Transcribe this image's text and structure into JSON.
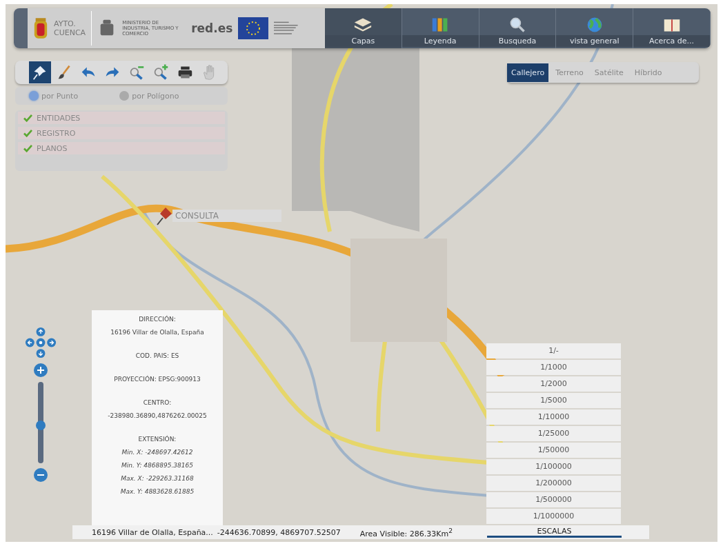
{
  "header": {
    "logo_lines": [
      "AYTO.",
      "CUENCA"
    ],
    "ministry": "MINISTERIO DE INDUSTRIA, TURISMO Y COMERCIO",
    "brand": "red.es"
  },
  "nav": [
    {
      "kind": "layers",
      "label": "Capas",
      "selected": true
    },
    {
      "kind": "legend",
      "label": "Leyenda",
      "selected": false
    },
    {
      "kind": "search",
      "label": "Busqueda",
      "selected": false
    },
    {
      "kind": "globe",
      "label": "vista general",
      "selected": false
    },
    {
      "kind": "book",
      "label": "Acerca de...",
      "selected": false
    }
  ],
  "tools": [
    {
      "kind": "pin",
      "selected": true
    },
    {
      "kind": "brush",
      "selected": false
    },
    {
      "kind": "undo",
      "selected": false
    },
    {
      "kind": "redo",
      "selected": false
    },
    {
      "kind": "zoom-out",
      "selected": false
    },
    {
      "kind": "zoom-in",
      "selected": false
    },
    {
      "kind": "print",
      "selected": false
    },
    {
      "kind": "hand",
      "selected": false
    }
  ],
  "query_modes": [
    {
      "label": "por Punto",
      "selected": true
    },
    {
      "label": "por Polígono",
      "selected": false
    }
  ],
  "layers": [
    {
      "label": "ENTIDADES",
      "checked": true
    },
    {
      "label": "REGISTRO",
      "checked": true
    },
    {
      "label": "PLANOS",
      "checked": true
    }
  ],
  "map_types": [
    {
      "label": "Callejero",
      "selected": true
    },
    {
      "label": "Terreno",
      "selected": false
    },
    {
      "label": "Satélite",
      "selected": false
    },
    {
      "label": "Híbrido",
      "selected": false
    }
  ],
  "marker": {
    "label": "CONSULTA"
  },
  "zoom": {
    "level": 0.47
  },
  "info_panel": [
    {
      "kind": "plain",
      "lines": [
        "DIRECCIÓN:",
        "16196 Villar de Olalla, España"
      ]
    },
    {
      "kind": "plain",
      "lines": [
        "COD. PAIS: ES"
      ]
    },
    {
      "kind": "plain",
      "lines": [
        "PROYECCIÓN: EPSG:900913"
      ]
    },
    {
      "kind": "plain",
      "lines": [
        "CENTRO:",
        "-238980.36890,4876262.00025"
      ]
    },
    {
      "kind": "extent",
      "lines": [
        "EXTENSIÓN:",
        "Min. X: -248697.42612",
        "Min. Y: 4868895.38165",
        "Max. X: -229263.31168",
        "Max. Y: 4883628.61885"
      ]
    }
  ],
  "scales": [
    "1/-",
    "1/1000",
    "1/2000",
    "1/5000",
    "1/10000",
    "1/25000",
    "1/50000",
    "1/100000",
    "1/200000",
    "1/500000",
    "1/1000000"
  ],
  "scales_button": "ESCALAS",
  "status_bar": {
    "address": "16196 Villar de Olalla, España...",
    "coords": "-244636.70899, 4869707.52507",
    "area": "Area Visible: 286.33Km$^{2}$"
  }
}
